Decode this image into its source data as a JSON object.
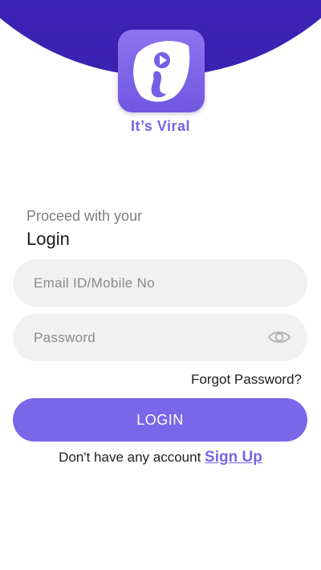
{
  "brand": {
    "name": "It’s Viral",
    "logo_icon": "brand-logo-leaf-i-play-icon",
    "header_color": "#3d24b8",
    "accent_color": "#7a62e6"
  },
  "login": {
    "subtitle": "Proceed with your",
    "title": "Login",
    "email_placeholder": "Email ID/Mobile No",
    "email_value": "",
    "password_placeholder": "Password",
    "password_value": "",
    "password_toggle_icon": "eye-icon",
    "forgot_password": "Forgot Password?",
    "submit_label": "LOGIN"
  },
  "signup": {
    "prompt": "Don't have any account ",
    "link_label": "Sign Up"
  }
}
